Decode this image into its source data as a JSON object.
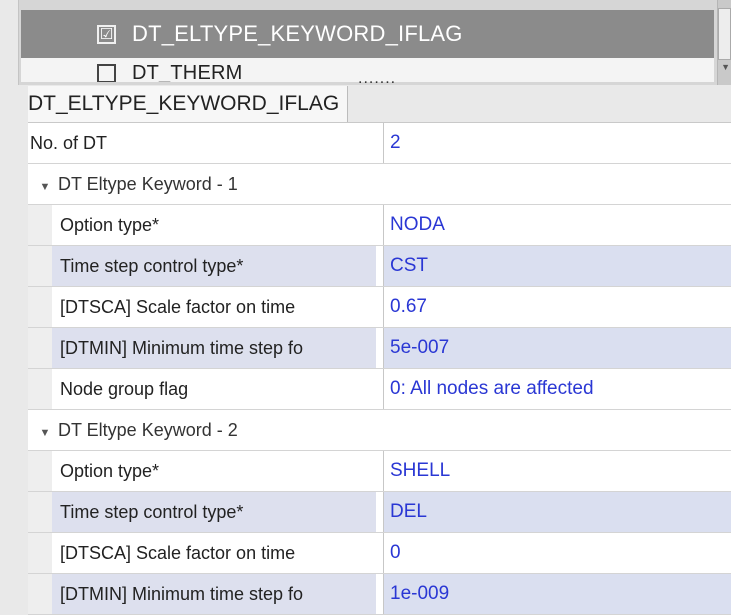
{
  "keyword_list": {
    "items": [
      {
        "label": "DT_ELTYPE_KEYWORD_IFLAG",
        "checked": true,
        "check_glyph": "☑"
      },
      {
        "label": "DT_THERM",
        "checked": false
      }
    ],
    "splitter_dots": "......."
  },
  "property_panel": {
    "title": "DT_ELTYPE_KEYWORD_IFLAG",
    "top_rows": [
      {
        "label": "No. of DT",
        "value": "2"
      }
    ],
    "groups": [
      {
        "label": "DT Eltype Keyword - 1",
        "rows": [
          {
            "label": "Option type*",
            "value": "NODA"
          },
          {
            "label": "Time step control type*",
            "value": "CST"
          },
          {
            "label": "[DTSCA] Scale factor on time",
            "value": "0.67"
          },
          {
            "label": "[DTMIN] Minimum time step fo",
            "value": "5e-007"
          },
          {
            "label": "Node group flag",
            "value": "0: All nodes are affected"
          }
        ]
      },
      {
        "label": "DT Eltype Keyword - 2",
        "rows": [
          {
            "label": "Option type*",
            "value": "SHELL"
          },
          {
            "label": "Time step control type*",
            "value": "DEL"
          },
          {
            "label": "[DTSCA] Scale factor on time",
            "value": "0"
          },
          {
            "label": "[DTMIN] Minimum time step fo",
            "value": "1e-009"
          }
        ]
      }
    ]
  },
  "colors": {
    "value_text": "#2a37d4",
    "selected_row_bg": "#8b8b8b",
    "alt_row_bg": "#dadff0"
  },
  "icons": {
    "group_caret": "chevron-down-icon",
    "scroll": "scrollbar"
  }
}
